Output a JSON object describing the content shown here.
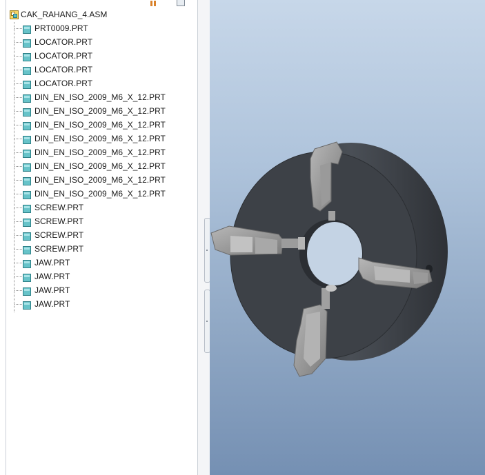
{
  "model_tree": {
    "root": {
      "label": "CAK_RAHANG_4.ASM",
      "icon": "assembly-icon"
    },
    "items": [
      {
        "label": "PRT0009.PRT",
        "icon": "part-icon"
      },
      {
        "label": "LOCATOR.PRT",
        "icon": "part-icon"
      },
      {
        "label": "LOCATOR.PRT",
        "icon": "part-icon"
      },
      {
        "label": "LOCATOR.PRT",
        "icon": "part-icon"
      },
      {
        "label": "LOCATOR.PRT",
        "icon": "part-icon"
      },
      {
        "label": "DIN_EN_ISO_2009_M6_X_12.PRT",
        "icon": "part-icon"
      },
      {
        "label": "DIN_EN_ISO_2009_M6_X_12.PRT",
        "icon": "part-icon"
      },
      {
        "label": "DIN_EN_ISO_2009_M6_X_12.PRT",
        "icon": "part-icon"
      },
      {
        "label": "DIN_EN_ISO_2009_M6_X_12.PRT",
        "icon": "part-icon"
      },
      {
        "label": "DIN_EN_ISO_2009_M6_X_12.PRT",
        "icon": "part-icon"
      },
      {
        "label": "DIN_EN_ISO_2009_M6_X_12.PRT",
        "icon": "part-icon"
      },
      {
        "label": "DIN_EN_ISO_2009_M6_X_12.PRT",
        "icon": "part-icon"
      },
      {
        "label": "DIN_EN_ISO_2009_M6_X_12.PRT",
        "icon": "part-icon"
      },
      {
        "label": "SCREW.PRT",
        "icon": "part-icon"
      },
      {
        "label": "SCREW.PRT",
        "icon": "part-icon"
      },
      {
        "label": "SCREW.PRT",
        "icon": "part-icon"
      },
      {
        "label": "SCREW.PRT",
        "icon": "part-icon"
      },
      {
        "label": "JAW.PRT",
        "icon": "part-icon"
      },
      {
        "label": "JAW.PRT",
        "icon": "part-icon"
      },
      {
        "label": "JAW.PRT",
        "icon": "part-icon"
      },
      {
        "label": "JAW.PRT",
        "icon": "part-icon"
      }
    ]
  },
  "colors": {
    "viewport_top": "#c7d7e9",
    "viewport_bottom": "#7590b3",
    "chuck_body": "#3d4147",
    "jaw_metal": "#8a8a8a",
    "part_icon": "#67c3c9"
  }
}
